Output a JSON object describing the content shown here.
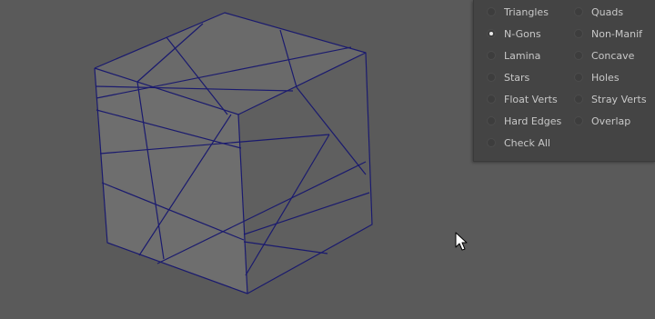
{
  "viewport": {
    "background": "#5a5a5a",
    "mesh_edge_color": "#1a1a6e",
    "face_colors": {
      "front": "#6e6e6e",
      "top": "#6a6a6a",
      "right": "#5f5f5f"
    }
  },
  "cleanup_panel": {
    "options": [
      {
        "label": "Triangles",
        "checked": false
      },
      {
        "label": "Quads",
        "checked": false
      },
      {
        "label": "N-Gons",
        "checked": true
      },
      {
        "label": "Non-Manif",
        "checked": false
      },
      {
        "label": "Lamina",
        "checked": false
      },
      {
        "label": "Concave",
        "checked": false
      },
      {
        "label": "Stars",
        "checked": false
      },
      {
        "label": "Holes",
        "checked": false
      },
      {
        "label": "Float Verts",
        "checked": false
      },
      {
        "label": "Stray Verts",
        "checked": false
      },
      {
        "label": "Hard Edges",
        "checked": false
      },
      {
        "label": "Overlap",
        "checked": false
      },
      {
        "label": "Check All",
        "checked": false
      }
    ]
  },
  "cursor": {
    "icon": "arrow-cursor-icon"
  }
}
